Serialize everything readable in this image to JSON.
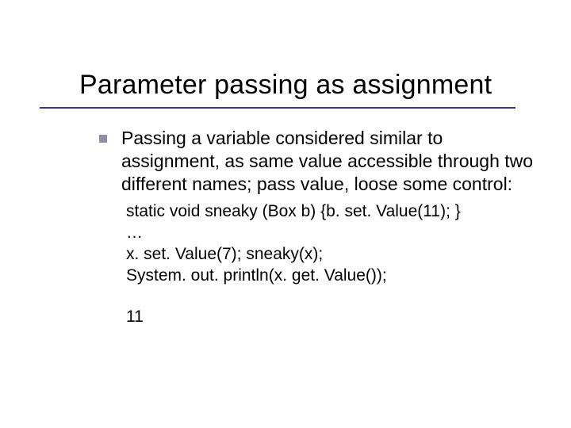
{
  "title": "Parameter passing as assignment",
  "body": {
    "paragraph": "Passing a variable considered similar to assignment, as same value accessible through two different names; pass value, loose some control:",
    "code": {
      "line1": "static void sneaky (Box b) {b. set. Value(11); }",
      "line2": "…",
      "line3": "x. set. Value(7); sneaky(x);",
      "line4": "System. out. println(x. get. Value());"
    },
    "output": "11"
  }
}
